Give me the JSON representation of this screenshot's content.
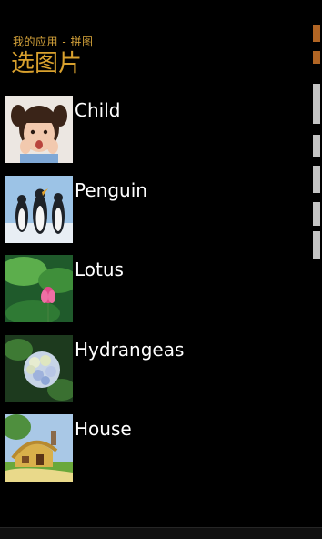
{
  "header": {
    "app_title": "我的应用 - 拼图",
    "page_title": "选图片"
  },
  "items": [
    {
      "label": "Child",
      "thumb_icon": "child-photo"
    },
    {
      "label": "Penguin",
      "thumb_icon": "penguin-photo"
    },
    {
      "label": "Lotus",
      "thumb_icon": "lotus-photo"
    },
    {
      "label": "Hydrangeas",
      "thumb_icon": "hydrangeas-photo"
    },
    {
      "label": "House",
      "thumb_icon": "house-photo"
    }
  ],
  "colors": {
    "accent": "#d9a12e",
    "background": "#000000",
    "text": "#ffffff"
  }
}
